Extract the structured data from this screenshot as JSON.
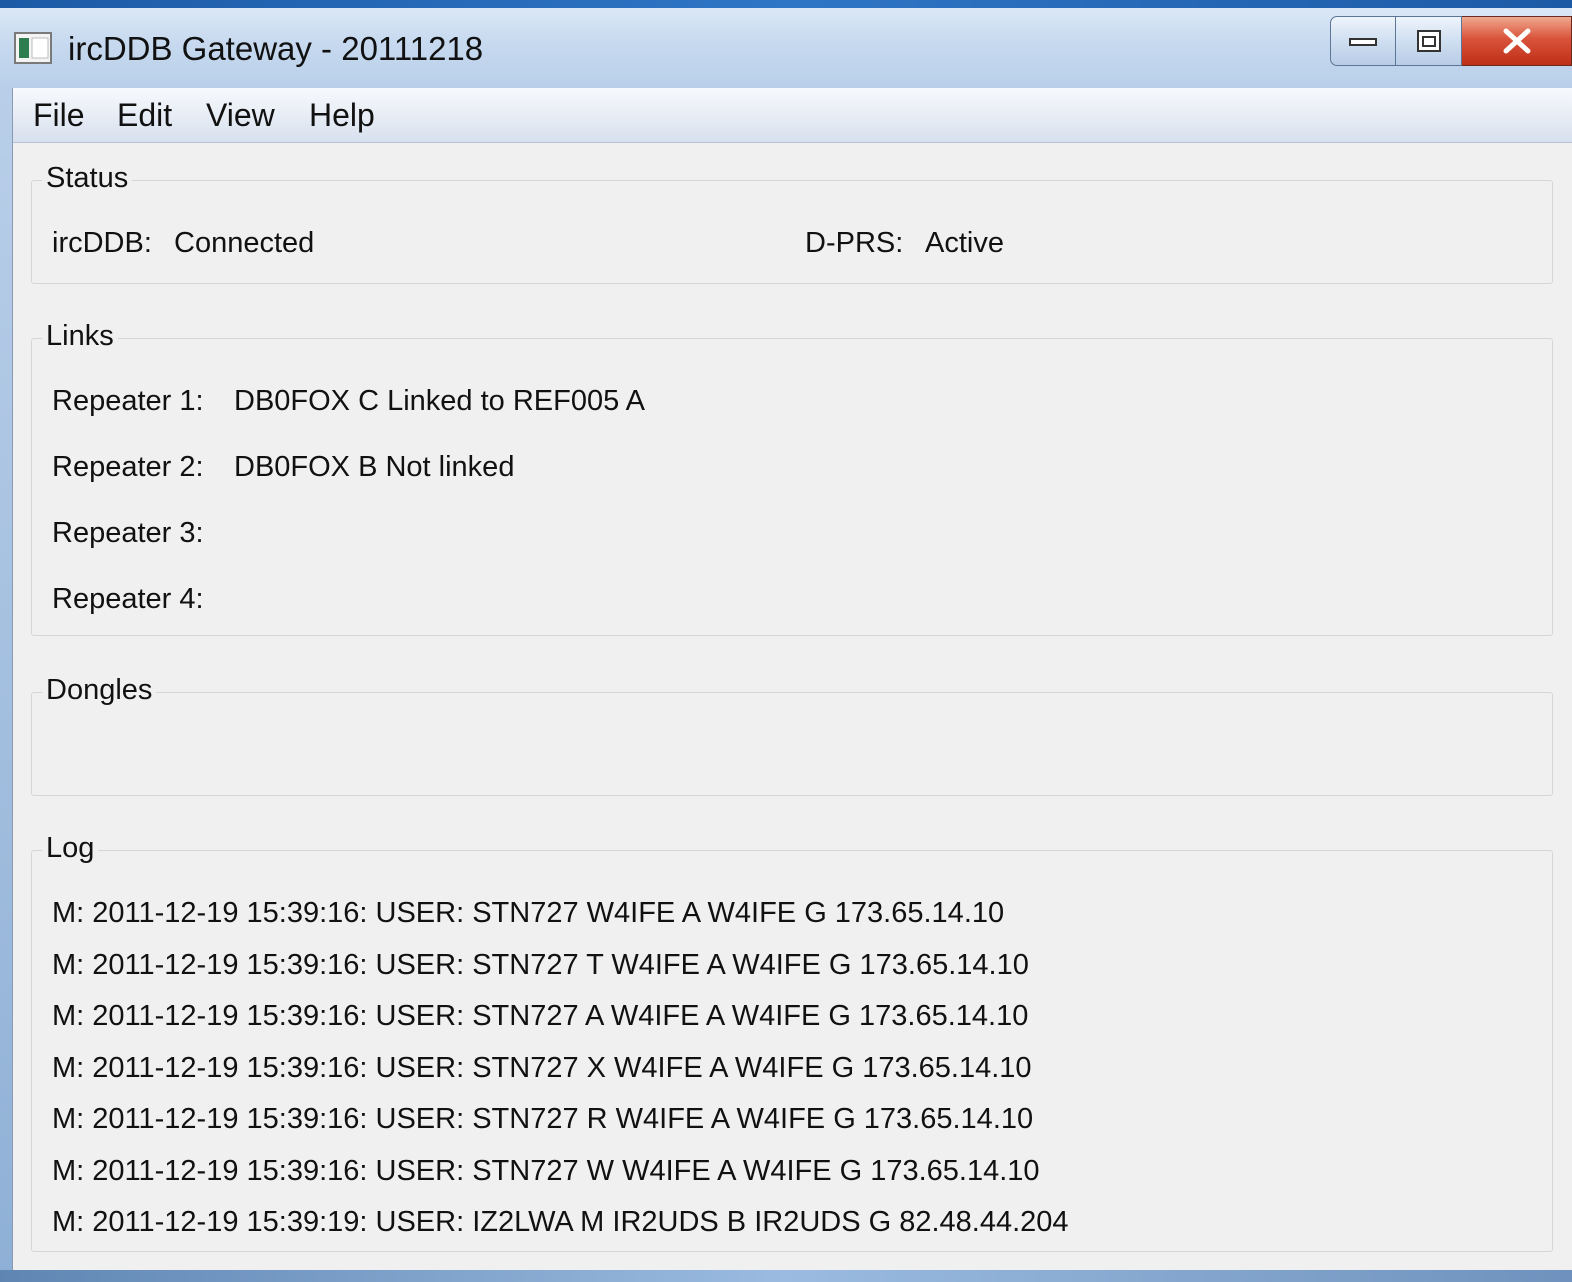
{
  "window": {
    "title": "ircDDB Gateway - 20111218"
  },
  "menu": [
    "File",
    "Edit",
    "View",
    "Help"
  ],
  "status": {
    "title": "Status",
    "ircddb_label": "ircDDB:",
    "ircddb_value": "Connected",
    "dprs_label": "D-PRS:",
    "dprs_value": "Active"
  },
  "links": {
    "title": "Links",
    "rows": [
      {
        "label": "Repeater 1:",
        "value": "DB0FOX C  Linked to  REF005 A"
      },
      {
        "label": "Repeater 2:",
        "value": "DB0FOX B  Not linked"
      },
      {
        "label": "Repeater 3:",
        "value": ""
      },
      {
        "label": "Repeater 4:",
        "value": ""
      }
    ]
  },
  "dongles": {
    "title": "Dongles"
  },
  "log": {
    "title": "Log",
    "lines": [
      "M: 2011-12-19 15:39:16: USER: STN727   W4IFE  A W4IFE  G 173.65.14.10",
      "M: 2011-12-19 15:39:16: USER: STN727 T W4IFE  A W4IFE  G 173.65.14.10",
      "M: 2011-12-19 15:39:16: USER: STN727 A W4IFE  A W4IFE  G 173.65.14.10",
      "M: 2011-12-19 15:39:16: USER: STN727 X W4IFE  A W4IFE  G 173.65.14.10",
      "M: 2011-12-19 15:39:16: USER: STN727 R W4IFE  A W4IFE  G 173.65.14.10",
      "M: 2011-12-19 15:39:16: USER: STN727 W W4IFE  A W4IFE  G 173.65.14.10",
      "M: 2011-12-19 15:39:19: USER: IZ2LWA M IR2UDS B IR2UDS G 82.48.44.204"
    ]
  }
}
